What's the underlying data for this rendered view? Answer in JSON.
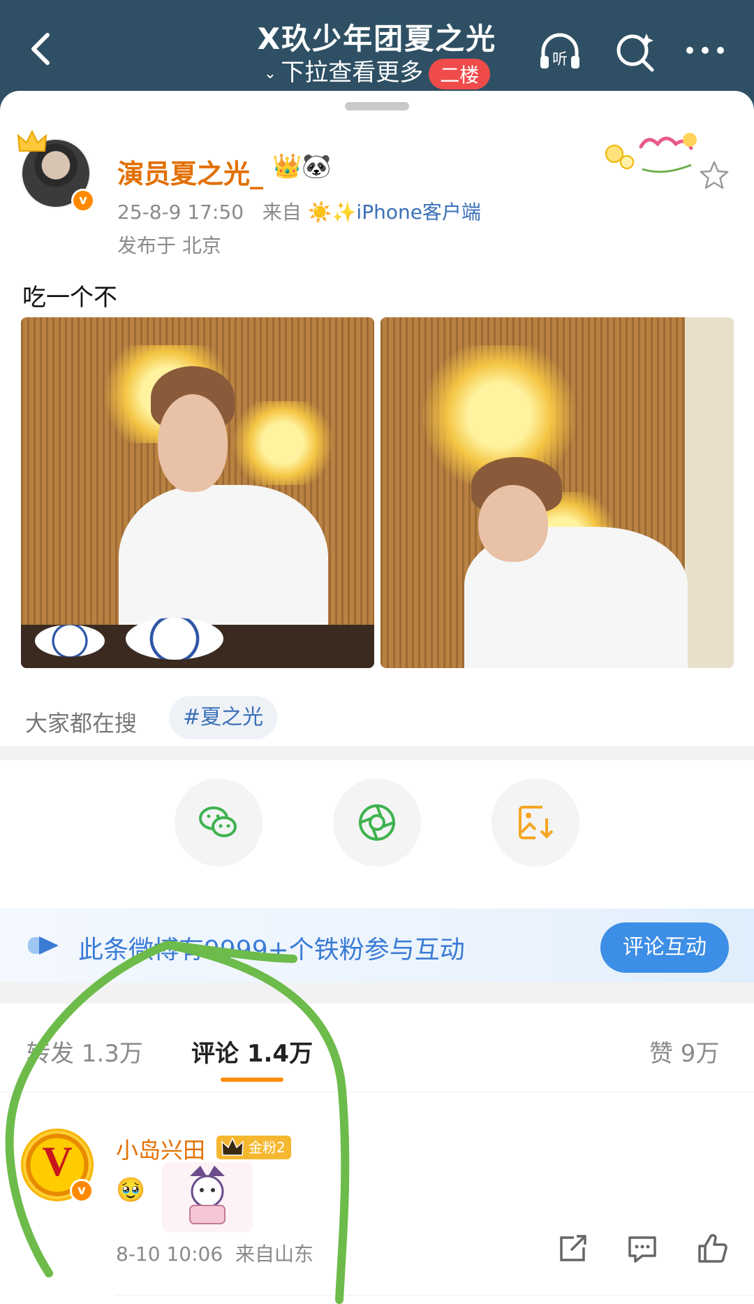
{
  "header": {
    "title": "X玖少年团夏之光",
    "subtitle": "下拉查看更多",
    "floor_badge": "二楼",
    "listen_label": "听"
  },
  "post": {
    "author": "演员夏之光_",
    "author_icons": "👑🐼",
    "time": "25-8-9 17:50",
    "source_prefix": "来自",
    "source": "☀️✨iPhone客户端",
    "location": "发布于 北京",
    "text": "吃一个不",
    "photo_count": 2
  },
  "search": {
    "label": "大家都在搜",
    "tag": "#夏之光"
  },
  "share": [
    "wechat-icon",
    "moments-icon",
    "save-image-icon"
  ],
  "fans_bar": {
    "text": "此条微博有9999+个铁粉参与互动",
    "button": "评论互动"
  },
  "tabs": [
    {
      "label": "转发 1.3万"
    },
    {
      "label": "评论 1.4万"
    },
    {
      "label": "赞 9万"
    }
  ],
  "comment": {
    "avatar_letter": "V",
    "name": "小岛兴田",
    "badge": "金粉2",
    "emoji": "🥹",
    "time": "8-10 10:06",
    "location": "来自山东"
  },
  "colors": {
    "header_bg": "#2f5064",
    "accent": "#ff8a00",
    "link": "#3a6fb7",
    "scribble": "#6dbb4a"
  }
}
